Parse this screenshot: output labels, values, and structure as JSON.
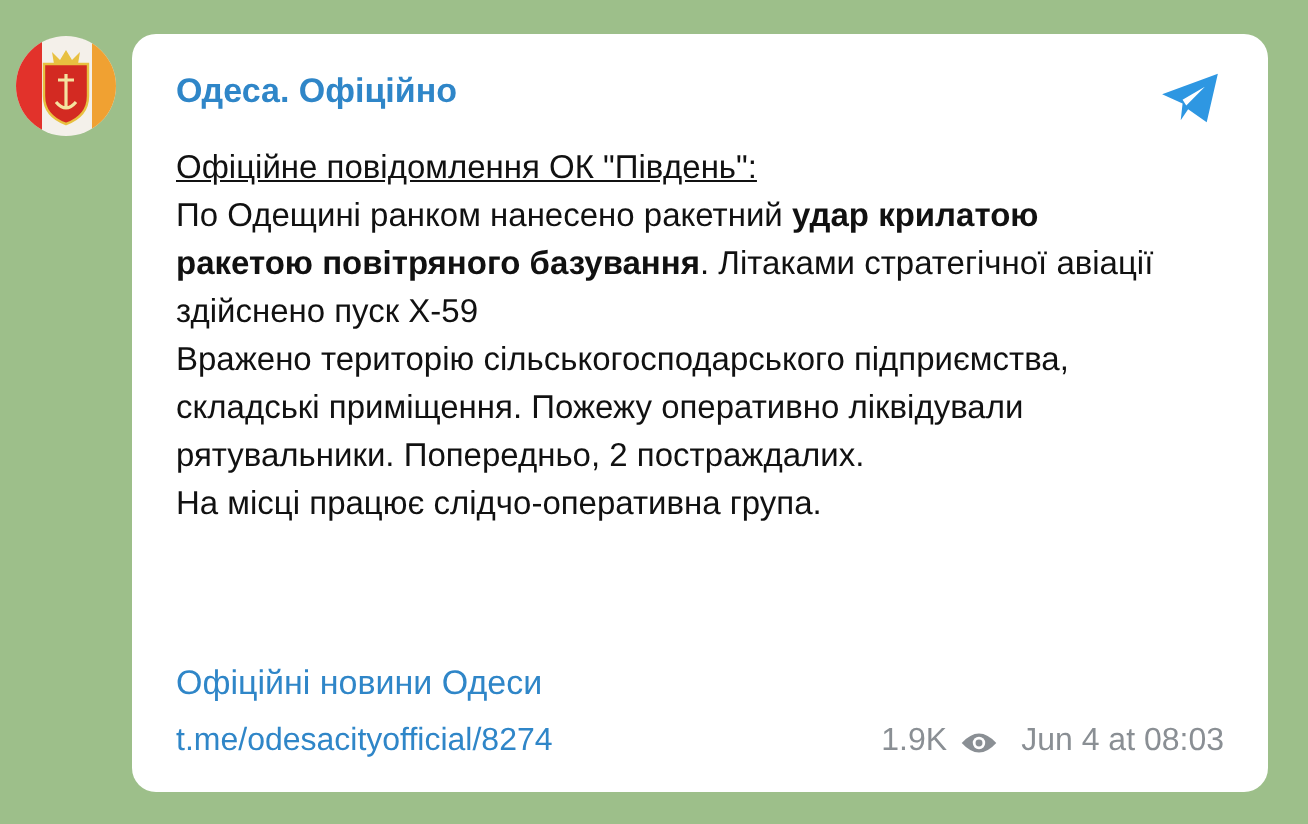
{
  "post": {
    "channel": "Одеса. Офіційно",
    "paragraphs": [
      {
        "kind": "heading",
        "text": "Офіційне повідомлення ОК \"Південь\":"
      },
      {
        "kind": "text",
        "text": "По Одещині ранком нанесено ракетний **удар крилатою ракетою повітряного базування**. Літаками стратегічної авіації здійснено пуск Х-59"
      },
      {
        "kind": "text",
        "text": "Вражено територію сільськогосподарського підприємства, складські приміщення. Пожежу оперативно ліквідували рятувальники. Попередньо, 2 постраждалих."
      },
      {
        "kind": "text",
        "text": "На місці працює слідчо-оперативна група."
      }
    ],
    "signature": "Офіційні новини Одеси",
    "link": "t.me/odesacityofficial/8274",
    "views": "1.9K",
    "date": "Jun 4 at 08:03"
  }
}
